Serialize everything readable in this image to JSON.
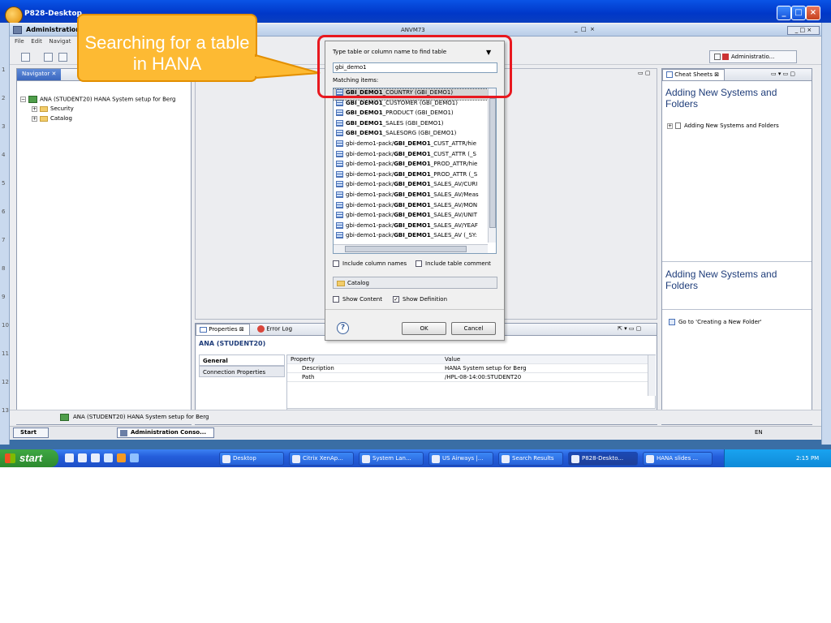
{
  "outer_window": {
    "title": "P828-Desktop"
  },
  "eclipse": {
    "title": "Administration",
    "center_title": "ANVM73",
    "menu": [
      "File",
      "Edit",
      "Navigat"
    ],
    "perspective_label": "Administratio..."
  },
  "callout": {
    "text": "Searching for a table in HANA"
  },
  "left_numbers": [
    "1",
    "2",
    "3",
    "4",
    "5",
    "6",
    "7",
    "8",
    "9",
    "10",
    "11",
    "12",
    "13"
  ],
  "navigator": {
    "tab_label": "Navigator",
    "tree": [
      {
        "label": "ANA (STUDENT20) HANA System setup for Berg",
        "level": 0,
        "icon": "system-icon"
      },
      {
        "label": "Security",
        "level": 1,
        "icon": "folder-icon"
      },
      {
        "label": "Catalog",
        "level": 1,
        "icon": "folder-icon"
      }
    ]
  },
  "dialog": {
    "prompt": "Type table or column name to find table",
    "search_value": "gbi_demo1",
    "matching_label": "Matching items:",
    "items": [
      {
        "pre": "",
        "bold": "GBI_DEMO1",
        "post": "_COUNTRY (GBI_DEMO1)"
      },
      {
        "pre": "",
        "bold": "GBI_DEMO1",
        "post": "_CUSTOMER (GBI_DEMO1)"
      },
      {
        "pre": "",
        "bold": "GBI_DEMO1",
        "post": "_PRODUCT (GBI_DEMO1)"
      },
      {
        "pre": "",
        "bold": "GBI_DEMO1",
        "post": "_SALES (GBI_DEMO1)"
      },
      {
        "pre": "",
        "bold": "GBI_DEMO1",
        "post": "_SALESORG (GBI_DEMO1)"
      },
      {
        "pre": "gbi-demo1-pack/",
        "bold": "GBI_DEMO1",
        "post": "_CUST_ATTR/hie"
      },
      {
        "pre": "gbi-demo1-pack/",
        "bold": "GBI_DEMO1",
        "post": "_CUST_ATTR (_S"
      },
      {
        "pre": "gbi-demo1-pack/",
        "bold": "GBI_DEMO1",
        "post": "_PROD_ATTR/hie"
      },
      {
        "pre": "gbi-demo1-pack/",
        "bold": "GBI_DEMO1",
        "post": "_PROD_ATTR (_S"
      },
      {
        "pre": "gbi-demo1-pack/",
        "bold": "GBI_DEMO1",
        "post": "_SALES_AV/CURI"
      },
      {
        "pre": "gbi-demo1-pack/",
        "bold": "GBI_DEMO1",
        "post": "_SALES_AV/Meas"
      },
      {
        "pre": "gbi-demo1-pack/",
        "bold": "GBI_DEMO1",
        "post": "_SALES_AV/MON"
      },
      {
        "pre": "gbi-demo1-pack/",
        "bold": "GBI_DEMO1",
        "post": "_SALES_AV/UNIT"
      },
      {
        "pre": "gbi-demo1-pack/",
        "bold": "GBI_DEMO1",
        "post": "_SALES_AV/YEAF"
      },
      {
        "pre": "gbi-demo1-pack/",
        "bold": "GBI_DEMO1",
        "post": "_SALES_AV (_SY:"
      }
    ],
    "include_column_names": "Include column names",
    "include_table_comment": "Include table comment",
    "schema": "Catalog",
    "show_content": "Show Content",
    "show_definition": "Show Definition",
    "ok": "OK",
    "cancel": "Cancel",
    "help": "?"
  },
  "cheat_sheets": {
    "tab_label": "Cheat Sheets",
    "title": "Adding New Systems and Folders",
    "item": "Adding New Systems and Folders",
    "lower_title": "Adding New Systems and Folders",
    "link": "Go to 'Creating a New Folder'"
  },
  "properties": {
    "tab_label": "Properties",
    "error_tab": "Error Log",
    "header": "ANA (STUDENT20)",
    "sections": [
      "General",
      "Connection Properties"
    ],
    "columns": [
      "Property",
      "Value"
    ],
    "rows": [
      {
        "property": "Description",
        "value": "HANA System setup for Berg"
      },
      {
        "property": "Path",
        "value": "/HPL-08-14:00:STUDENT20"
      }
    ]
  },
  "status_bar": {
    "text": "ANA (STUDENT20) HANA System setup for Berg"
  },
  "inner_taskbar": {
    "start": "Start",
    "app": "Administration Conso...",
    "lang": "EN"
  },
  "xp_taskbar": {
    "start": "start",
    "tasks": [
      "Desktop",
      "Citrix XenAp...",
      "System Lan...",
      "US Airways |...",
      "Search Results",
      "P828-Deskto...",
      "HANA slides ..."
    ],
    "clock": "2:15 PM"
  },
  "colors": {
    "callout_fill": "#fdba33",
    "highlight_frame": "#e8181f",
    "xp_blue": "#245edb",
    "xp_green": "#3fa743"
  }
}
